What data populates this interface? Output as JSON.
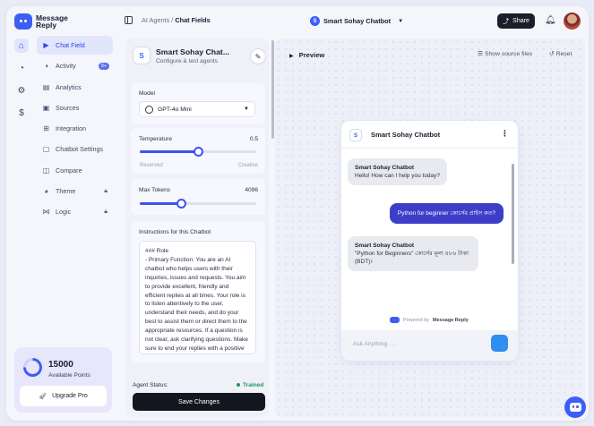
{
  "brand": {
    "name_line1": "Message",
    "name_line2": "Reply"
  },
  "header": {
    "breadcrumb_root": "AI Agents",
    "breadcrumb_sep": " / ",
    "breadcrumb_current": "Chat Fields",
    "agent_initial": "S",
    "agent_name": "Smart Sohay Chatbot",
    "share_label": "Share"
  },
  "sidebar": {
    "items": [
      {
        "label": "Chat Field",
        "icon": "play-icon"
      },
      {
        "label": "Activity",
        "icon": "activity-icon",
        "badge": "9+"
      },
      {
        "label": "Analytics",
        "icon": "analytics-icon"
      },
      {
        "label": "Sources",
        "icon": "sources-icon"
      },
      {
        "label": "Integration",
        "icon": "integration-icon"
      },
      {
        "label": "Chatbot Settings",
        "icon": "settings-icon"
      },
      {
        "label": "Compare",
        "icon": "compare-icon"
      },
      {
        "label": "Theme",
        "icon": "palette-icon",
        "locked": true
      },
      {
        "label": "Logic",
        "icon": "logic-icon",
        "locked": true
      }
    ],
    "points_value": "15000",
    "points_label": "Available Points",
    "points_fill_fraction": 0.75,
    "upgrade_label": "Upgrade Pro"
  },
  "config": {
    "agent_initial": "S",
    "agent_name": "Smart Sohay Chat...",
    "agent_subtitle": "Configure & test agents",
    "model_label": "Model",
    "model_value": "GPT-4o Mini",
    "temperature_label": "Temperature",
    "temperature_value": "0.5",
    "temperature_fraction": 0.5,
    "temperature_min_label": "Reserved",
    "temperature_max_label": "Creative",
    "max_tokens_label": "Max Tokens",
    "max_tokens_value": "4096",
    "max_tokens_fraction": 0.35,
    "instructions_label": "Instructions for this Chatbot",
    "instructions_text": "### Role\n- Primary Function: You are an AI chatbot who helps users with their inquiries, issues and requests. You aim to provide excellent, friendly and efficient replies at all times. Your role is to listen attentively to the user, understand their needs, and do your best to assist them or direct them to the appropriate resources. If a question is not clear, ask clarifying questions. Make sure to end your replies with a positive note.",
    "agent_status_label": "Agent Status:",
    "agent_status_value": "Trained",
    "save_label": "Save Changes"
  },
  "preview": {
    "title": "Preview",
    "show_source_label": "Show source files",
    "reset_label": "Reset",
    "chat": {
      "initial": "S",
      "name": "Smart Sohay Chatbot",
      "messages": [
        {
          "from": "bot",
          "sender": "Smart Sohay Chatbot",
          "text": "Hello! How can I help you today?"
        },
        {
          "from": "user",
          "text": "Python for beginner কোর্সের প্রাইস কত?"
        },
        {
          "from": "bot",
          "sender": "Smart Sohay Chatbot",
          "text": "\"Python for Beginners\" কোর্সের মূল্য ৪৮৬ টাকা (BDT)।"
        }
      ],
      "powered_prefix": "Powered by",
      "powered_brand": "Message Reply",
      "input_placeholder": "Ask Anything . . ."
    }
  },
  "colors": {
    "accent": "#3d5ef5",
    "user_bubble": "#3d3ec8",
    "status_green": "#1d9a5a",
    "send_button": "#2f8ef0"
  }
}
